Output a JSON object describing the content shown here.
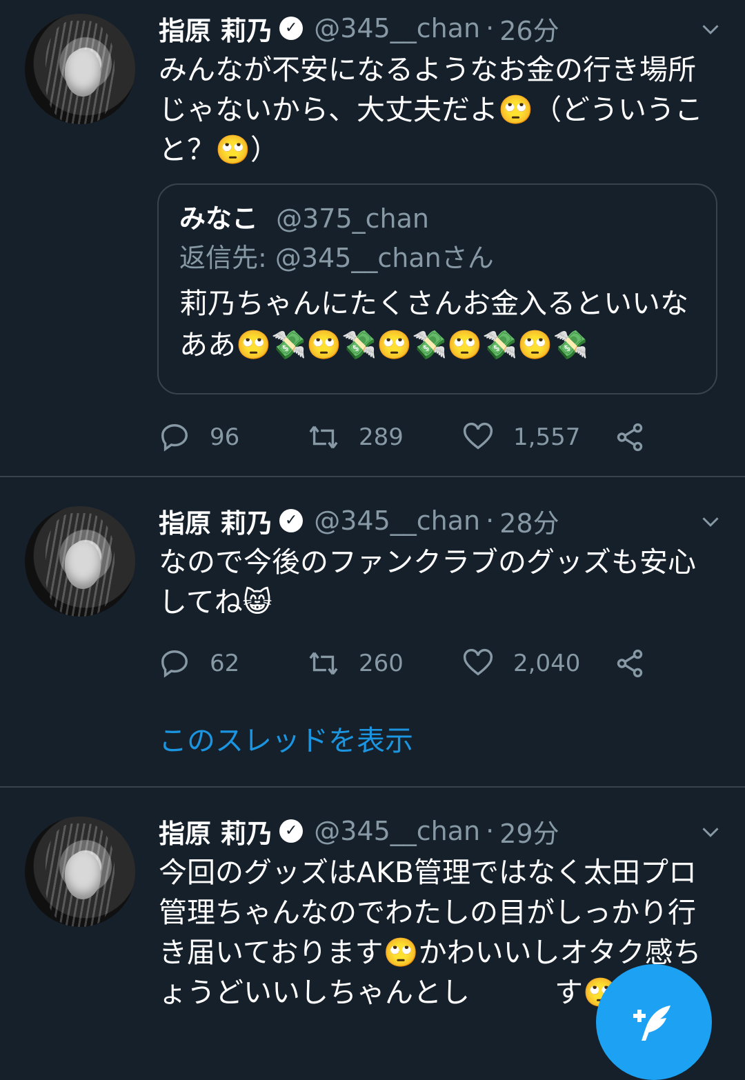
{
  "tweets": [
    {
      "name": "指原 莉乃",
      "handle": "@345__chan",
      "time": "26分",
      "text": "みんなが不安になるようなお金の行き場所じゃないから、大丈夫だよ🙄（どういうこと？🙄）",
      "quote": {
        "name": "みなこ",
        "handle": "@375_chan",
        "reply_to": "返信先: @345__chanさん",
        "text": "莉乃ちゃんにたくさんお金入るといいなああ🙄💸🙄💸🙄💸🙄💸🙄💸"
      },
      "replies": "96",
      "retweets": "289",
      "likes": "1,557"
    },
    {
      "name": "指原 莉乃",
      "handle": "@345__chan",
      "time": "28分",
      "text": "なので今後のファンクラブのグッズも安心してね😸",
      "replies": "62",
      "retweets": "260",
      "likes": "2,040",
      "thread_link": "このスレッドを表示"
    },
    {
      "name": "指原 莉乃",
      "handle": "@345__chan",
      "time": "29分",
      "text": "今回のグッズはAKB管理ではなく太田プロ管理ちゃんなのでわたしの目がしっかり行き届いております🙄かわいいしオタク感ちょうどいいしちゃんとし　　　す🙄"
    }
  ],
  "icons": {
    "verified": "verified-badge-icon",
    "more": "chevron-down-icon",
    "reply": "reply-icon",
    "retweet": "retweet-icon",
    "like": "heart-icon",
    "share": "share-icon",
    "compose": "compose-tweet-icon"
  },
  "colors": {
    "background": "#15202b",
    "secondary_text": "#8899a6",
    "accent": "#1da1f2",
    "link": "#1b95e0",
    "border": "#38444d"
  }
}
